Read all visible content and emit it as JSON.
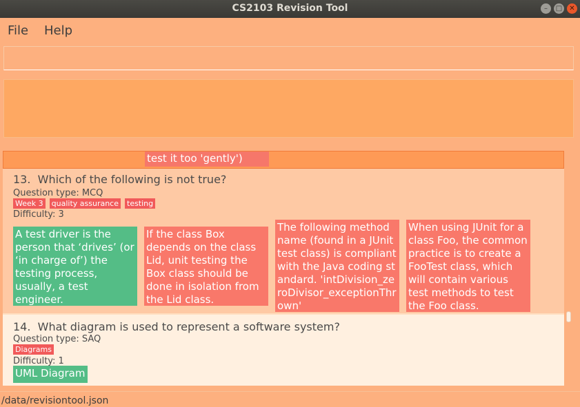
{
  "window": {
    "title": "CS2103 Revision Tool"
  },
  "menu": {
    "file": "File",
    "help": "Help"
  },
  "command_box": {
    "value": ""
  },
  "result_box": {
    "text": ""
  },
  "previous_card": {
    "visible_option": "test it too 'gently')"
  },
  "questions": [
    {
      "number": "13.",
      "text": "Which of the following is not true?",
      "type": "Question type: MCQ",
      "tags": [
        "Week 3",
        "quality assurance",
        "testing"
      ],
      "difficulty": "Difficulty: 3",
      "options": [
        {
          "text": "A test driver is the person that ‘drives’ (or ‘in charge of’) the testing process, usually, a test engineer.",
          "status": "correct"
        },
        {
          "text": "If the class Box depends on the class Lid, unit testing the Box class should be done in isolation from the Lid class.",
          "status": "wrong"
        },
        {
          "text": "The following method name (found in a JUnit test class) is compliant with the Java coding standard. 'intDivision_zeroDivisor_exceptionThrown'",
          "status": "wrong"
        },
        {
          "text": "When using JUnit for a class Foo, the common practice is to create a FooTest class, which will contain various test methods to test the Foo class.",
          "status": "wrong"
        }
      ]
    },
    {
      "number": "14.",
      "text": "What diagram is used to represent a software system?",
      "type": "Question type: SAQ",
      "tags": [
        "Diagrams"
      ],
      "difficulty": "Difficulty: 1",
      "options": [
        {
          "text": "UML Diagram",
          "status": "correct"
        }
      ]
    }
  ],
  "status_bar": {
    "path": "/data/revisiontool.json"
  },
  "colors": {
    "correct": "#54bd86",
    "wrong": "#f9786a",
    "tag": "#f15a5a",
    "background": "#fdb07f"
  }
}
